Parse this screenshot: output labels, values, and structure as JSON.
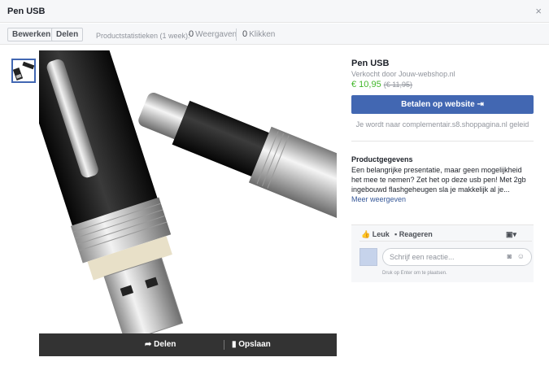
{
  "header": {
    "title": "Pen USB",
    "close": "×"
  },
  "toolbar": {
    "edit_label": "Bewerken",
    "share_label": "Delen",
    "stats_label": "Productstatistieken (1 week):",
    "views_count": "0",
    "views_label": "Weergaven",
    "clicks_count": "0",
    "clicks_label": "Klikken"
  },
  "image_bar": {
    "share_label": "Delen",
    "save_label": "Opslaan"
  },
  "product": {
    "title": "Pen USB",
    "seller": "Verkocht door Jouw-webshop.nl",
    "price": "€ 10,95",
    "old_price": "(€ 11,95)",
    "pay_button": "Betalen op website",
    "redirect_note": "Je wordt naar complementair.s8.shoppagina.nl geleid",
    "details_title": "Productgegevens",
    "description": "Een belangrijke presentatie, maar geen mogelijkheid het mee te nemen? Zet het op deze usb pen! Met 2gb ingebouwd flashgeheugen sla je makkelijk al je...",
    "more_link": "Meer weergeven"
  },
  "comments": {
    "like_label": "Leuk",
    "comment_label": "Reageren",
    "input_placeholder": "Schrijf een reactie...",
    "hint": "Druk op Enter om te plaatsen."
  },
  "colors": {
    "accent": "#4267b2",
    "price": "#42b72a",
    "link": "#365899"
  }
}
